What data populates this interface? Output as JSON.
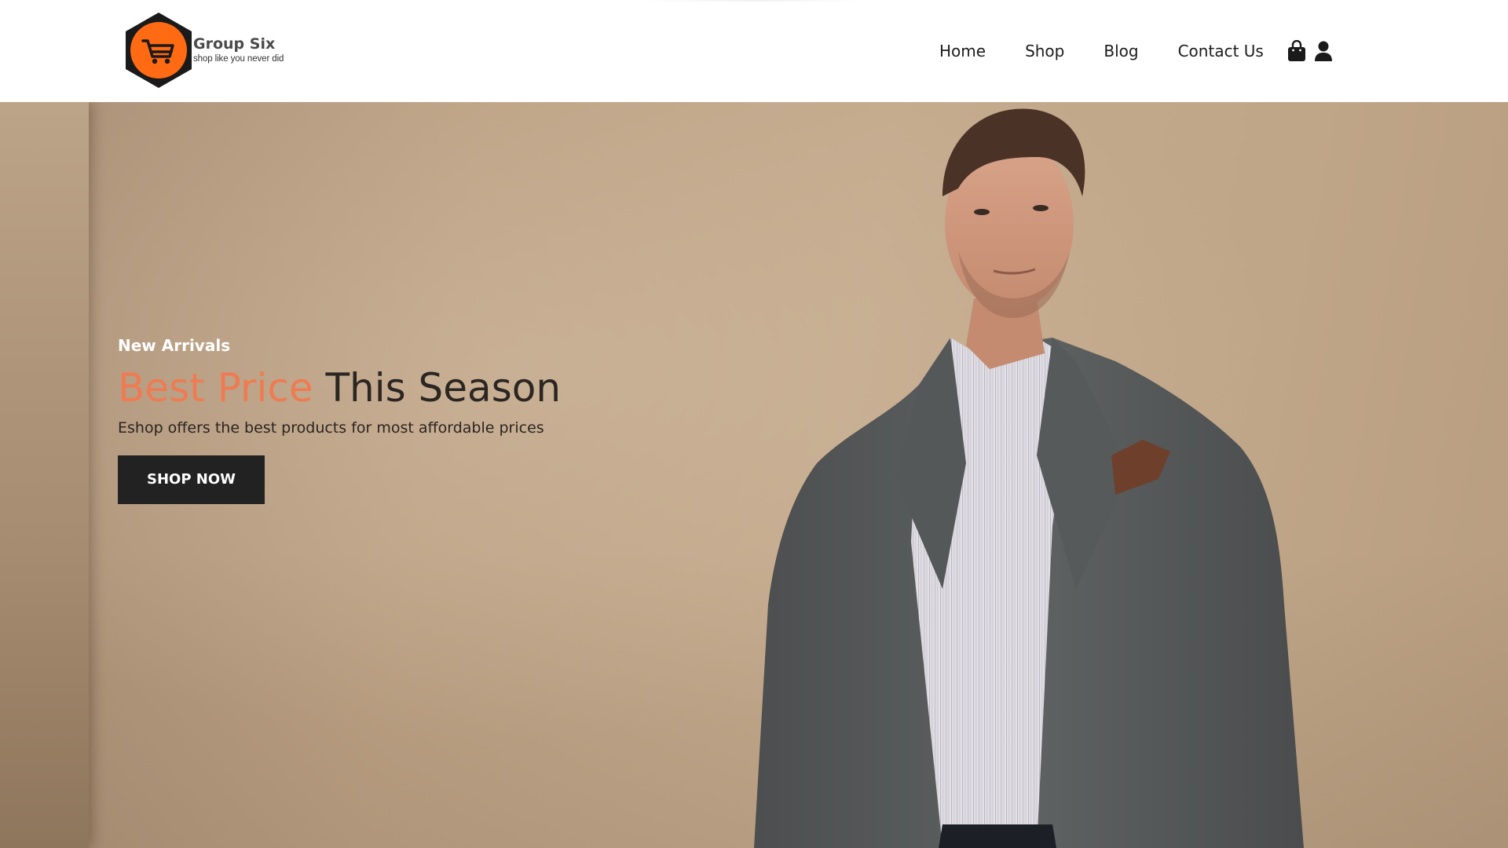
{
  "brand": {
    "name": "Group Six",
    "tagline": "shop like you never did",
    "logo_icon": "shopping-cart-icon",
    "logo_color": "#ff6a13"
  },
  "nav": {
    "items": [
      {
        "label": "Home"
      },
      {
        "label": "Shop"
      },
      {
        "label": "Blog"
      },
      {
        "label": "Contact Us"
      }
    ],
    "icons": [
      "shopping-bag-icon",
      "user-icon"
    ]
  },
  "hero": {
    "eyebrow": "New Arrivals",
    "title_accent": "Best Price",
    "title_rest": " This Season",
    "subtitle": "Eshop offers the best products for most affordable prices",
    "cta_label": "SHOP NOW",
    "accent_color": "#ef7b52"
  }
}
